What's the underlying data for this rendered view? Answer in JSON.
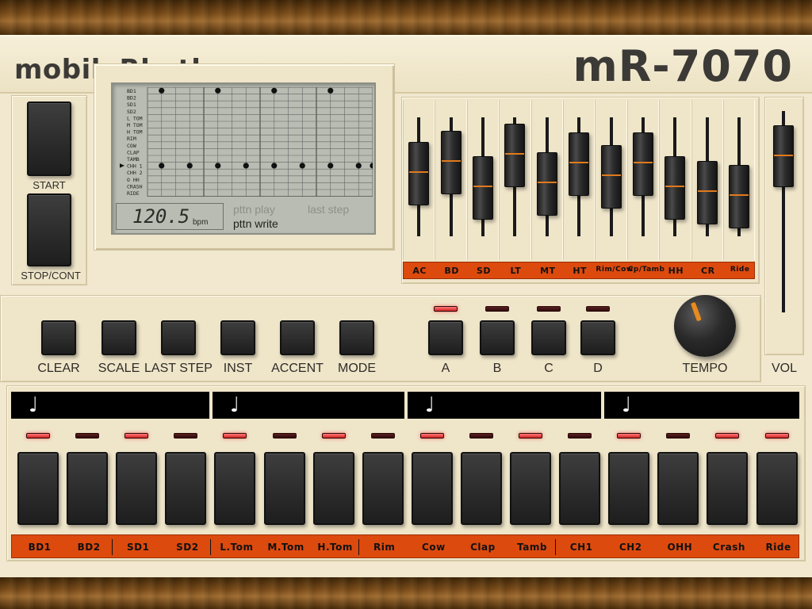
{
  "app": {
    "brand": "mobileRhythm",
    "model": "mR-7070"
  },
  "transport": {
    "start_label": "START",
    "stop_label": "STOP/CONT"
  },
  "lcd": {
    "instruments": [
      "BD1",
      "BD2",
      "SD1",
      "SD2",
      "L TOM",
      "M TOM",
      "H TOM",
      "RIM",
      "COW",
      "CLAP",
      "TAMB",
      "CHH 1",
      "CHH 2",
      "O HH",
      "CRASH",
      "RIDE"
    ],
    "selected_instrument": "CHH 1",
    "tempo": "120.5",
    "tempo_unit": "bpm",
    "modes": {
      "play": "pttn play",
      "last_step": "last step",
      "write": "pttn write"
    },
    "active_mode": "pttn write",
    "pattern": {
      "BD1": [
        1,
        0,
        0,
        0,
        1,
        0,
        0,
        0,
        1,
        0,
        0,
        0,
        1,
        0,
        0,
        0
      ],
      "CHH 1": [
        1,
        0,
        1,
        0,
        1,
        0,
        1,
        0,
        1,
        0,
        1,
        0,
        1,
        0,
        1,
        1
      ]
    }
  },
  "mixer": {
    "channels": [
      {
        "label": "AC",
        "level": 0.55
      },
      {
        "label": "BD",
        "level": 0.7
      },
      {
        "label": "SD",
        "level": 0.35
      },
      {
        "label": "LT",
        "level": 0.8
      },
      {
        "label": "MT",
        "level": 0.4
      },
      {
        "label": "HT",
        "level": 0.68
      },
      {
        "label": "Rim/Cow",
        "level": 0.5
      },
      {
        "label": "Cp/Tamb",
        "level": 0.68
      },
      {
        "label": "HH",
        "level": 0.35
      },
      {
        "label": "CR",
        "level": 0.28
      },
      {
        "label": "Ride",
        "level": 0.22
      }
    ],
    "volume_label": "VOL",
    "volume_level": 0.88
  },
  "controls": {
    "buttons": [
      "CLEAR",
      "SCALE",
      "LAST STEP",
      "INST",
      "ACCENT",
      "MODE"
    ],
    "patterns": [
      {
        "label": "A",
        "active": true
      },
      {
        "label": "B",
        "active": false
      },
      {
        "label": "C",
        "active": false
      },
      {
        "label": "D",
        "active": false
      }
    ],
    "tempo_label": "TEMPO",
    "note_symbol": "♩"
  },
  "steps": {
    "leds": [
      1,
      0,
      1,
      0,
      1,
      0,
      1,
      0,
      1,
      0,
      1,
      0,
      1,
      0,
      1,
      1
    ],
    "labels": [
      "BD1",
      "BD2",
      "SD1",
      "SD2",
      "L.Tom",
      "M.Tom",
      "H.Tom",
      "Rim",
      "Cow",
      "Clap",
      "Tamb",
      "CH1",
      "CH2",
      "OHH",
      "Crash",
      "Ride"
    ]
  }
}
